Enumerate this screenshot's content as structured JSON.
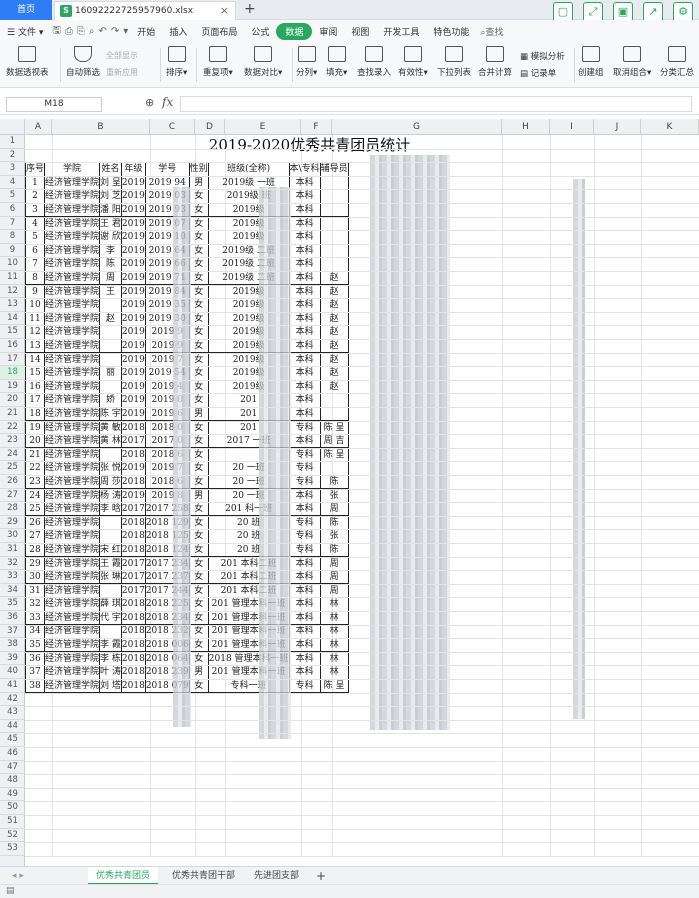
{
  "tabs": {
    "home": "首页",
    "file": "16092222725957960.xlsx"
  },
  "menu": [
    "文件",
    "开始",
    "插入",
    "页面布局",
    "公式",
    "数据",
    "审阅",
    "视图",
    "开发工具",
    "特色功能"
  ],
  "menu_active": "数据",
  "search": "查找",
  "ribbon": {
    "pivot": "数据透视表",
    "autofilter": "自动筛选",
    "showall": "全部显示",
    "reapply": "重新应用",
    "sort": "排序",
    "dup": "重复项",
    "compare": "数据对比",
    "split": "分列",
    "fill": "填充",
    "lookup": "查找录入",
    "valid": "有效性",
    "dropdown": "下拉列表",
    "consolidate": "合并计算",
    "simulate": "模拟分析",
    "record": "记录单",
    "group": "创建组",
    "ungroup": "取消组合",
    "subtotal": "分类汇总"
  },
  "namebox": "M18",
  "columns": [
    "A",
    "B",
    "C",
    "D",
    "E",
    "F",
    "G",
    "H",
    "I",
    "J",
    "K"
  ],
  "title": "2019-2020优秀共青团员统计",
  "headers": [
    "序号",
    "学院",
    "姓名",
    "年级",
    "学号",
    "性别",
    "班级(全称)",
    "本\\专科",
    "辅导员"
  ],
  "rows": [
    [
      "1",
      "经济管理学院",
      "刘 呈",
      "2019",
      "2019 94",
      "男",
      "2019级 一班",
      "本科",
      ""
    ],
    [
      "2",
      "经济管理学院",
      "刘 芝",
      "2019",
      "2019 03",
      "女",
      "2019级 班",
      "本科",
      ""
    ],
    [
      "3",
      "经济管理学院",
      "潘 阳",
      "2019",
      "2019 93",
      "女",
      "2019级",
      "本科",
      ""
    ],
    [
      "4",
      "经济管理学院",
      "王 君",
      "2019",
      "2019 07",
      "女",
      "2019级",
      "本科",
      ""
    ],
    [
      "5",
      "经济管理学院",
      "谢 欣",
      "2019",
      "2019 10",
      "女",
      "2019级",
      "本科",
      ""
    ],
    [
      "6",
      "经济管理学院",
      "李",
      "2019",
      "2019 64",
      "女",
      "2019级 二班",
      "本科",
      ""
    ],
    [
      "7",
      "经济管理学院",
      "陈",
      "2019",
      "2019 66",
      "女",
      "2019级 二班",
      "本科",
      ""
    ],
    [
      "8",
      "经济管理学院",
      "周",
      "2019",
      "2019 71",
      "女",
      "2019级 二班",
      "本科",
      "赵"
    ],
    [
      "9",
      "经济管理学院",
      "王",
      "2019",
      "2019 84",
      "女",
      "2019级",
      "本科",
      "赵"
    ],
    [
      "10",
      "经济管理学院",
      "",
      "2019",
      "2019 35",
      "女",
      "2019级",
      "本科",
      "赵"
    ],
    [
      "11",
      "经济管理学院",
      "赵",
      "2019",
      "2019 30",
      "女",
      "2019级",
      "本科",
      "赵"
    ],
    [
      "12",
      "经济管理学院",
      "",
      "2019",
      "2019 9",
      "女",
      "2019级",
      "本科",
      "赵"
    ],
    [
      "13",
      "经济管理学院",
      "",
      "2019",
      "2019 9",
      "女",
      "2019级",
      "本科",
      "赵"
    ],
    [
      "14",
      "经济管理学院",
      "",
      "2019",
      "2019 7",
      "女",
      "2019级",
      "本科",
      "赵"
    ],
    [
      "15",
      "经济管理学院",
      "丽",
      "2019",
      "2019 54",
      "女",
      "2019级",
      "本科",
      "赵"
    ],
    [
      "16",
      "经济管理学院",
      "",
      "2019",
      "2019 4",
      "女",
      "2019级",
      "本科",
      "赵"
    ],
    [
      "17",
      "经济管理学院",
      "娇",
      "2019",
      "2019 0",
      "女",
      "201",
      "本科",
      ""
    ],
    [
      "18",
      "经济管理学院",
      "陈 宇",
      "2019",
      "2019 6",
      "男",
      "201",
      "本科",
      ""
    ],
    [
      "19",
      "经济管理学院",
      "黄 敏",
      "2018",
      "2018 0",
      "女",
      "201",
      "专科",
      "陈 呈"
    ],
    [
      "20",
      "经济管理学院",
      "黄 林",
      "2017",
      "2017 0",
      "女",
      "2017 一班",
      "本科",
      "周 吉"
    ],
    [
      "21",
      "经济管理学院",
      "",
      "2018",
      "2018 6",
      "女",
      "",
      "专科",
      "陈 呈"
    ],
    [
      "22",
      "经济管理学院",
      "张 悦",
      "2019",
      "2019 7",
      "女",
      "20 一班",
      "专科",
      ""
    ],
    [
      "23",
      "经济管理学院",
      "周 莎",
      "2018",
      "2018 6",
      "女",
      "20 一班",
      "专科",
      "陈"
    ],
    [
      "24",
      "经济管理学院",
      "杨 涛",
      "2019",
      "2019 8",
      "男",
      "20 一班",
      "本科",
      "张"
    ],
    [
      "25",
      "经济管理学院",
      "李 晗",
      "2017",
      "2017 258",
      "女",
      "201 科一班",
      "本科",
      "周"
    ],
    [
      "26",
      "经济管理学院",
      "",
      "2018",
      "2018 129",
      "女",
      "20 班",
      "专科",
      "陈"
    ],
    [
      "27",
      "经济管理学院",
      "",
      "2018",
      "2018 125",
      "女",
      "20 班",
      "专科",
      "张"
    ],
    [
      "28",
      "经济管理学院",
      "宋 红",
      "2018",
      "2018 124",
      "女",
      "20 班",
      "专科",
      "陈"
    ],
    [
      "29",
      "经济管理学院",
      "王 霞",
      "2017",
      "2017 234",
      "女",
      "201 本科二班",
      "本科",
      "周"
    ],
    [
      "30",
      "经济管理学院",
      "张 琳",
      "2017",
      "2017 237",
      "女",
      "201 本科二班",
      "本科",
      "周"
    ],
    [
      "31",
      "经济管理学院",
      "",
      "2017",
      "2017 244",
      "女",
      "201 本科二班",
      "本科",
      "周"
    ],
    [
      "32",
      "经济管理学院",
      "薛 琪",
      "2018",
      "2018 225",
      "女",
      "201 管理本科一班",
      "本科",
      "林"
    ],
    [
      "33",
      "经济管理学院",
      "代 宇",
      "2018",
      "2018 234",
      "女",
      "201 管理本科一班",
      "本科",
      "林"
    ],
    [
      "34",
      "经济管理学院",
      "",
      "2018",
      "2018 232",
      "女",
      "201 管理本科一班",
      "本科",
      "林"
    ],
    [
      "35",
      "经济管理学院",
      "李 霞",
      "2018",
      "2018 006",
      "女",
      "201 管理本科一班",
      "本科",
      "林"
    ],
    [
      "36",
      "经济管理学院",
      "李 栋",
      "2018",
      "2018 064",
      "女",
      "2018 管理本科一班",
      "本科",
      "林"
    ],
    [
      "37",
      "经济管理学院",
      "叶 涛",
      "2018",
      "2018 239",
      "男",
      "201 管理本科一班",
      "本科",
      "林"
    ],
    [
      "38",
      "经济管理学院",
      "刘 塔",
      "2018",
      "2018 079",
      "女",
      "专科一班",
      "专科",
      "陈 呈"
    ]
  ],
  "sheets": [
    "优秀共青团员",
    "优秀共青团干部",
    "先进团支部"
  ],
  "active_sheet": "优秀共青团员"
}
